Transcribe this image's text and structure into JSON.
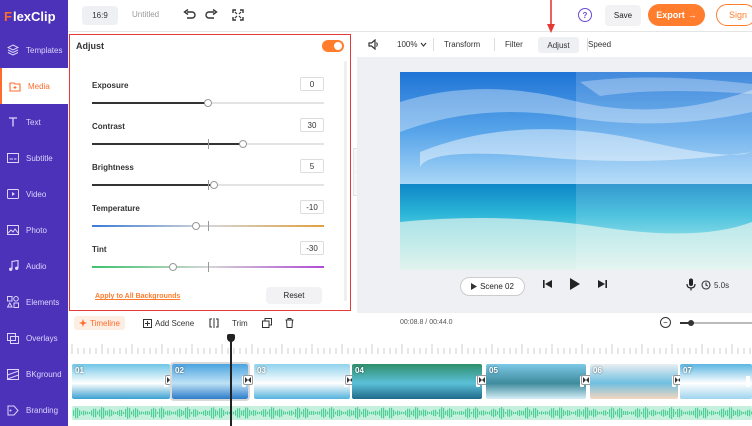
{
  "app": {
    "logo": "lexClip",
    "logo_letter": "F"
  },
  "sidebar": {
    "items": [
      {
        "label": "Templates",
        "icon": "templates-icon",
        "active": false
      },
      {
        "label": "Media",
        "icon": "media-icon",
        "active": true
      },
      {
        "label": "Text",
        "icon": "text-icon",
        "active": false
      },
      {
        "label": "Subtitle",
        "icon": "subtitle-icon",
        "active": false
      },
      {
        "label": "Video",
        "icon": "video-icon",
        "active": false
      },
      {
        "label": "Photo",
        "icon": "photo-icon",
        "active": false
      },
      {
        "label": "Audio",
        "icon": "audio-icon",
        "active": false
      },
      {
        "label": "Elements",
        "icon": "elements-icon",
        "active": false
      },
      {
        "label": "Overlays",
        "icon": "overlays-icon",
        "active": false
      },
      {
        "label": "BKground",
        "icon": "bkground-icon",
        "active": false
      },
      {
        "label": "Branding",
        "icon": "branding-icon",
        "active": false
      }
    ]
  },
  "topbar": {
    "ratio": "16:9",
    "title": "Untitled",
    "help": "?",
    "save_label": "Save",
    "export_label": "Export",
    "export_arrow": "→",
    "sign_label": "Sign"
  },
  "adjust_panel": {
    "title": "Adjust",
    "enabled": true,
    "sliders": [
      {
        "label": "Exposure",
        "value": "0",
        "position": 0.5,
        "track": "plain"
      },
      {
        "label": "Contrast",
        "value": "30",
        "position": 0.65,
        "track": "plain"
      },
      {
        "label": "Brightness",
        "value": "5",
        "position": 0.525,
        "track": "plain"
      },
      {
        "label": "Temperature",
        "value": "-10",
        "position": 0.45,
        "track": "temperature"
      },
      {
        "label": "Tint",
        "value": "-30",
        "position": 0.35,
        "track": "tint"
      }
    ],
    "apply_all_label": "Apply to All Backgrounds",
    "reset_label": "Reset"
  },
  "toolbar": {
    "zoom": "100%",
    "tabs": [
      "Transform",
      "Filter",
      "Adjust",
      "Speed"
    ],
    "active_tab": "Adjust"
  },
  "player": {
    "scene_label": "Scene 02",
    "duration": "5.0s"
  },
  "timeline": {
    "timeline_label": "Timeline",
    "add_scene_label": "Add Scene",
    "trim_label": "Trim",
    "current_time": "00:08.8",
    "separator": " / ",
    "total_time": "00:44.0",
    "zoom_level": 0.15,
    "clips": [
      {
        "num": "01",
        "selected": false
      },
      {
        "num": "02",
        "selected": true
      },
      {
        "num": "03",
        "selected": false
      },
      {
        "num": "04",
        "selected": false
      },
      {
        "num": "05",
        "selected": false
      },
      {
        "num": "06",
        "selected": false
      },
      {
        "num": "07",
        "selected": false
      }
    ]
  },
  "colors": {
    "brand": "#4b32b8",
    "accent": "#ff7d2d",
    "highlight": "#e53935"
  }
}
